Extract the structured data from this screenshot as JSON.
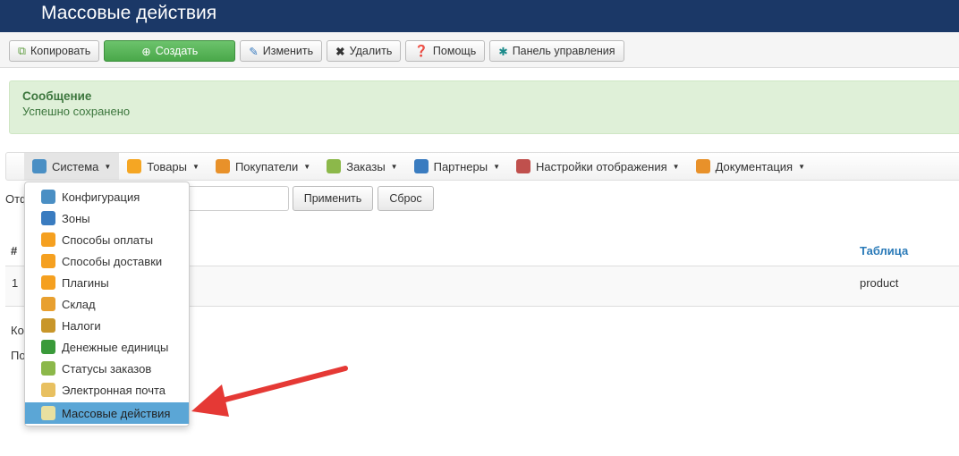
{
  "header": {
    "title": "Массовые действия"
  },
  "toolbar": {
    "copy": "Копировать",
    "create": "Создать",
    "edit": "Изменить",
    "delete": "Удалить",
    "help": "Помощь",
    "panel": "Панель управления"
  },
  "message": {
    "title": "Сообщение",
    "text": "Успешно сохранено"
  },
  "menu": [
    {
      "label": "Система",
      "color": "#4a8fc4"
    },
    {
      "label": "Товары",
      "color": "#f5a623"
    },
    {
      "label": "Покупатели",
      "color": "#e8912a"
    },
    {
      "label": "Заказы",
      "color": "#8cb84a"
    },
    {
      "label": "Партнеры",
      "color": "#3a7cc0"
    },
    {
      "label": "Настройки отображения",
      "color": "#c0504d"
    },
    {
      "label": "Документация",
      "color": "#e8912a"
    }
  ],
  "filter": {
    "label_fragment": "Отф",
    "apply": "Применить",
    "reset": "Сброс"
  },
  "table": {
    "col_num": "#",
    "col_table": "Таблица",
    "rows": [
      {
        "num": "1",
        "table": "product"
      }
    ]
  },
  "below": {
    "frag1": "Ко",
    "frag2": "По"
  },
  "dropdown": [
    {
      "label": "Конфигурация",
      "color": "#4a8fc4"
    },
    {
      "label": "Зоны",
      "color": "#3a7cc0"
    },
    {
      "label": "Способы оплаты",
      "color": "#f5a020"
    },
    {
      "label": "Способы доставки",
      "color": "#f5a020"
    },
    {
      "label": "Плагины",
      "color": "#f5a020"
    },
    {
      "label": "Склад",
      "color": "#e8a030"
    },
    {
      "label": "Налоги",
      "color": "#c8962a"
    },
    {
      "label": "Денежные единицы",
      "color": "#3a9a3a"
    },
    {
      "label": "Статусы заказов",
      "color": "#8cb84a"
    },
    {
      "label": "Электронная почта",
      "color": "#e8c060"
    },
    {
      "label": "Массовые действия",
      "color": "#e8e0a0"
    }
  ],
  "arrow_color": "#e53935"
}
